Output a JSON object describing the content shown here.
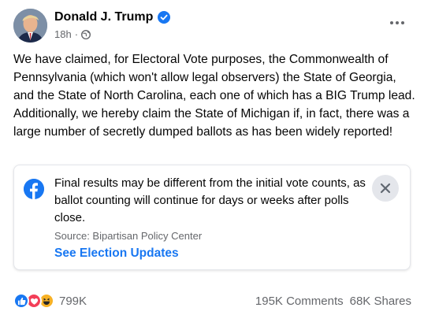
{
  "post": {
    "author": "Donald J. Trump",
    "timestamp": "18h",
    "audience_icon": "globe-icon",
    "body": "We have claimed, for Electoral Vote purposes, the Commonwealth of Pennsylvania (which won't allow legal observers) the State of Georgia, and the State of North Carolina, each one of which has a BIG Trump lead. Additionally, we hereby claim the State of Michigan if, in fact, there was a large number of secretly dumped ballots as has been widely reported!"
  },
  "notice": {
    "icon": "facebook-logo-icon",
    "text": "Final results may be different from the initial vote counts, as ballot counting will continue for days or weeks after polls close.",
    "source": "Source: Bipartisan Policy Center",
    "link": "See Election Updates"
  },
  "footer": {
    "reactions": [
      "like-icon",
      "love-icon",
      "haha-icon"
    ],
    "reaction_count": "799K",
    "comments": "195K Comments",
    "shares": "68K Shares"
  },
  "colors": {
    "accent": "#1877f2",
    "muted_text": "#65676b",
    "card_border": "#e4e6eb"
  }
}
